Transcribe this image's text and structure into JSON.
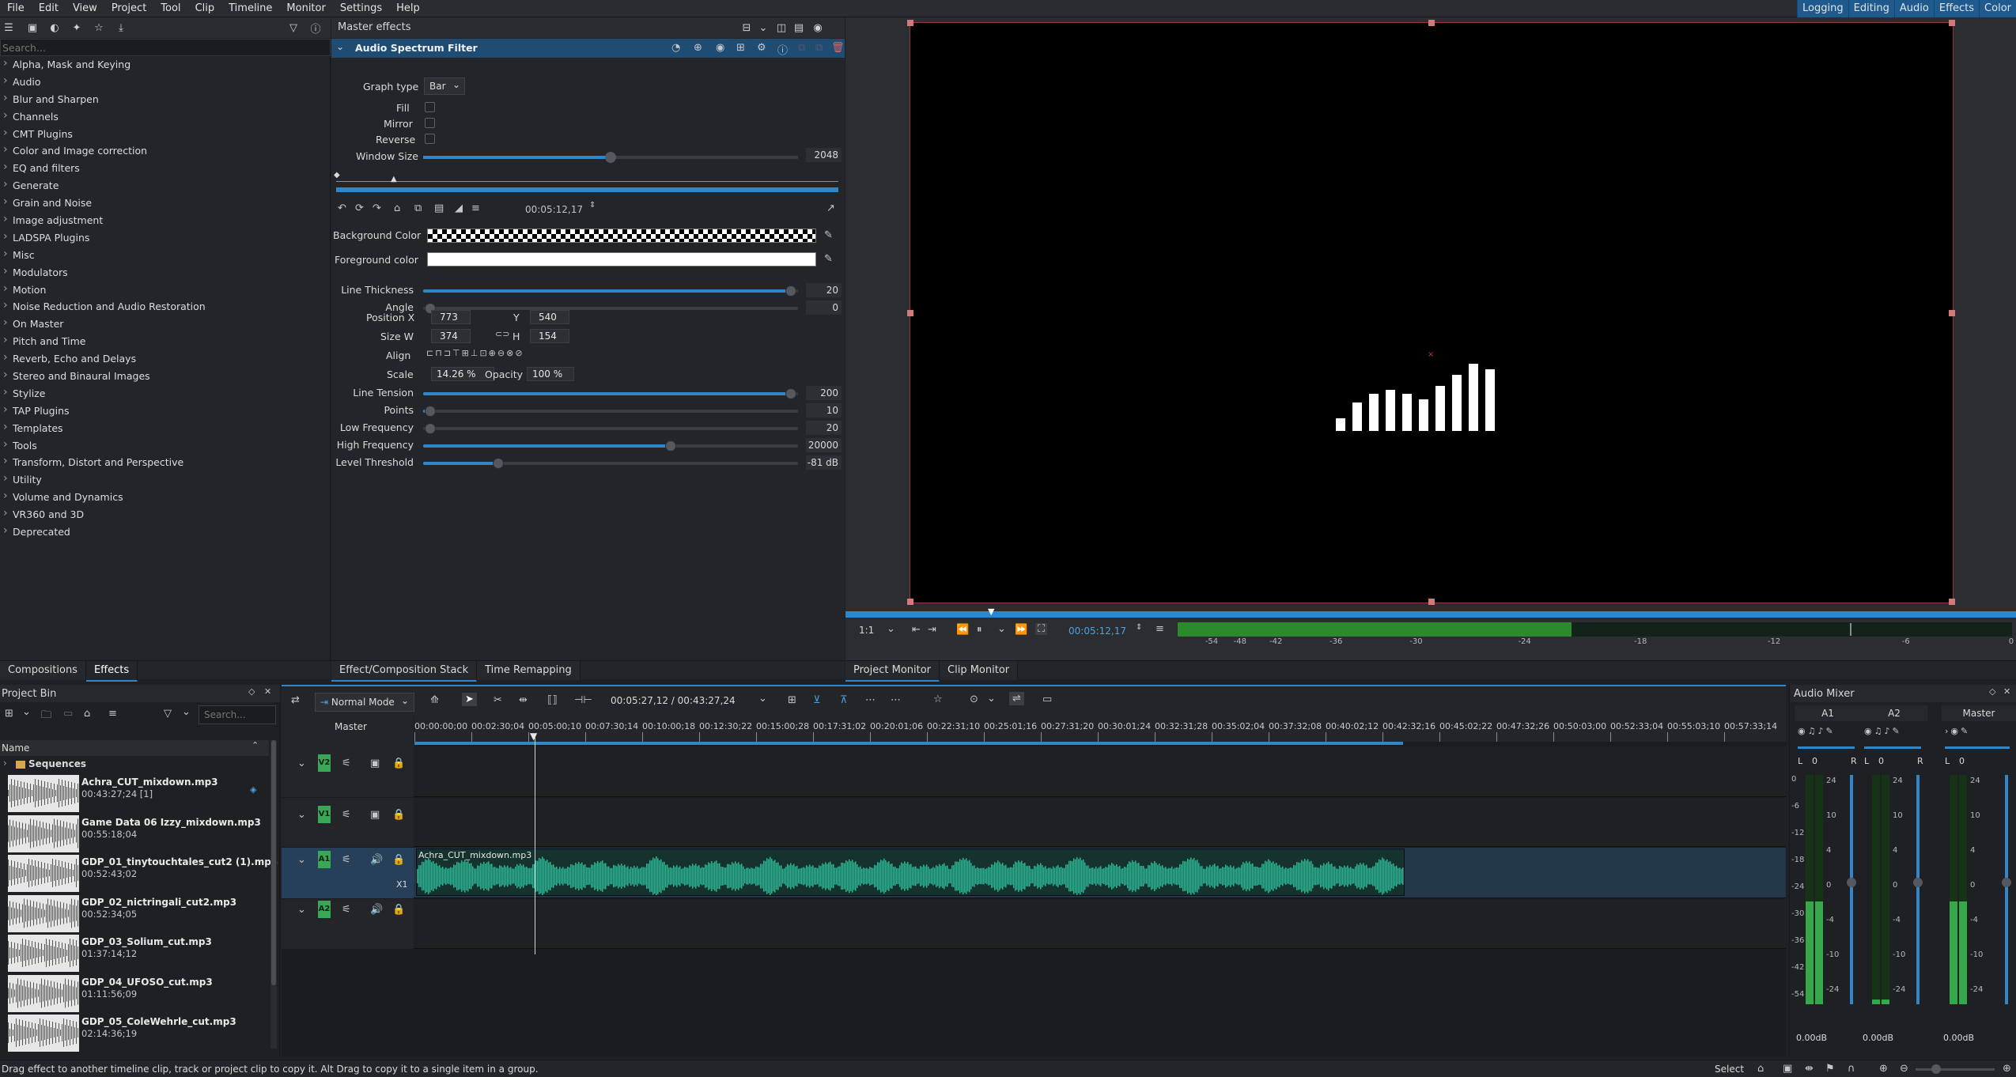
{
  "menubar": {
    "items": [
      "File",
      "Edit",
      "View",
      "Project",
      "Tool",
      "Clip",
      "Timeline",
      "Monitor",
      "Settings",
      "Help"
    ],
    "layouts": [
      "Logging",
      "Editing",
      "Audio",
      "Effects",
      "Color"
    ]
  },
  "effects_panel": {
    "search_placeholder": "Search...",
    "categories": [
      "Alpha, Mask and Keying",
      "Audio",
      "Blur and Sharpen",
      "Channels",
      "CMT Plugins",
      "Color and Image correction",
      "EQ and filters",
      "Generate",
      "Grain and Noise",
      "Image adjustment",
      "LADSPA Plugins",
      "Misc",
      "Modulators",
      "Motion",
      "Noise Reduction and Audio Restoration",
      "On Master",
      "Pitch and Time",
      "Reverb, Echo and Delays",
      "Stereo and Binaural Images",
      "Stylize",
      "TAP Plugins",
      "Templates",
      "Tools",
      "Transform, Distort and Perspective",
      "Utility",
      "Volume and Dynamics",
      "VR360 and 3D",
      "Deprecated"
    ],
    "tabs": [
      "Compositions",
      "Effects"
    ]
  },
  "effect_stack": {
    "title": "Master effects",
    "filter_name": "Audio Spectrum Filter",
    "graph_type_label": "Graph type",
    "graph_type_value": "Bar",
    "fill_label": "Fill",
    "mirror_label": "Mirror",
    "reverse_label": "Reverse",
    "window_size_label": "Window Size",
    "window_size_value": "2048",
    "window_size_level": 0.5,
    "timecode": "00:05:12,17",
    "bg_color_label": "Background Color",
    "fg_color_label": "Foreground color",
    "line_thickness_label": "Line Thickness",
    "line_thickness_value": "20",
    "line_thickness_level": 0.98,
    "angle_label": "Angle",
    "angle_value": "0",
    "angle_level": 0.0,
    "position_label": "Position X",
    "position_x": "773",
    "y_label": "Y",
    "position_y": "540",
    "size_label": "Size W",
    "size_w": "374",
    "h_label": "H",
    "size_h": "154",
    "align_label": "Align",
    "scale_label": "Scale",
    "scale_value": "14.26 %",
    "opacity_label": "Opacity",
    "opacity_value": "100 %",
    "line_tension_label": "Line Tension",
    "line_tension_value": "200",
    "line_tension_level": 0.98,
    "points_label": "Points",
    "points_value": "10",
    "points_level": 0.02,
    "low_freq_label": "Low Frequency",
    "low_freq_value": "20",
    "low_freq_level": 0.0,
    "high_freq_label": "High Frequency",
    "high_freq_value": "20000",
    "high_freq_level": 0.66,
    "level_threshold_label": "Level Threshold",
    "level_threshold_value": "-81 dB",
    "level_threshold_level": 0.2,
    "tabs": [
      "Effect/Composition Stack",
      "Time Remapping"
    ]
  },
  "monitor": {
    "zoom": "1:1",
    "timecode": "00:05:12,17",
    "meter_scale": [
      "-54",
      "-48",
      "-42",
      "-36",
      "-30",
      "-24",
      "-18",
      "-12",
      "-6",
      "0"
    ],
    "tabs": [
      "Project Monitor",
      "Clip Monitor"
    ],
    "spectrum_bars": [
      0.15,
      0.35,
      0.45,
      0.5,
      0.45,
      0.38,
      0.55,
      0.68,
      0.82,
      0.75
    ]
  },
  "project_bin": {
    "title": "Project Bin",
    "search_placeholder": "Search...",
    "column": "Name",
    "folder": "Sequences",
    "items": [
      {
        "name": "Achra_CUT_mixdown.mp3",
        "duration": "00:43:27;24 [1]"
      },
      {
        "name": "Game Data 06 Izzy_mixdown.mp3",
        "duration": "00:55:18;04"
      },
      {
        "name": "GDP_01_tinytouchtales_cut2 (1).mp3",
        "duration": "00:52:43;02"
      },
      {
        "name": "GDP_02_nictringali_cut2.mp3",
        "duration": "00:52:34;05"
      },
      {
        "name": "GDP_03_Solium_cut.mp3",
        "duration": "01:37:14;12"
      },
      {
        "name": "GDP_04_UFOSO_cut.mp3",
        "duration": "01:11:56;09"
      },
      {
        "name": "GDP_05_ColeWehrle_cut.mp3",
        "duration": "02:14:36;19"
      }
    ]
  },
  "timeline": {
    "mode": "Normal Mode",
    "timecode": "00:05:27,12 / 00:43:27,24",
    "master_label": "Master",
    "ruler": [
      "00:00:00;00",
      "00:02:30;04",
      "00:05:00;10",
      "00:07:30;14",
      "00:10:00;18",
      "00:12:30;22",
      "00:15:00;28",
      "00:17:31;02",
      "00:20:01;06",
      "00:22:31;10",
      "00:25:01;16",
      "00:27:31;20",
      "00:30:01;24",
      "00:32:31;28",
      "00:35:02;04",
      "00:37:32;08",
      "00:40:02;12",
      "00:42:32;16",
      "00:45:02;22",
      "00:47:32;26",
      "00:50:03;00",
      "00:52:33;04",
      "00:55:03;10",
      "00:57:33;14"
    ],
    "tracks": [
      "V2",
      "V1",
      "A1",
      "A2"
    ],
    "clip_name": "Achra_CUT_mixdown.mp3",
    "x1": "X1"
  },
  "mixer": {
    "title": "Audio Mixer",
    "channels": [
      "A1",
      "A2",
      "Master"
    ],
    "pan": "0",
    "l": "L",
    "r": "R",
    "db": "0.00dB",
    "scale": [
      "24",
      "10",
      "4",
      "0",
      "-4",
      "-10",
      "-24"
    ],
    "level_scale": [
      "0",
      "-6",
      "-12",
      "-18",
      "-24",
      "-30",
      "-36",
      "-42",
      "-54"
    ],
    "levels": [
      0.45,
      0.02,
      0.45,
      0.45
    ]
  },
  "status": {
    "message": "Drag effect to another timeline clip, track or project clip to copy it. Alt Drag to copy it to a single item in a group.",
    "select": "Select"
  },
  "colors": {
    "accent": "#2f86c8",
    "track_green": "#3aa658",
    "waveform": "#2bb494"
  }
}
